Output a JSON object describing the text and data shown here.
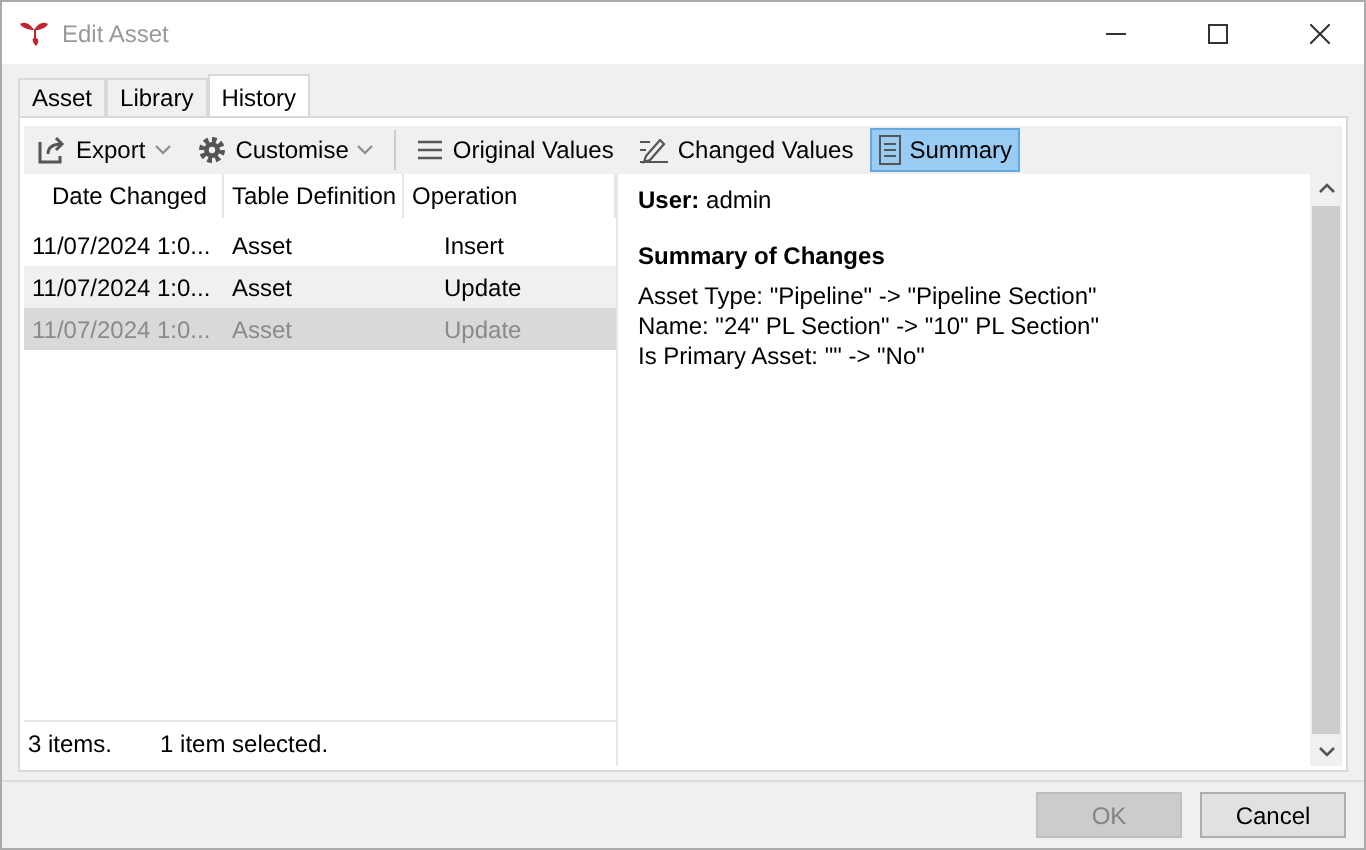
{
  "window": {
    "title": "Edit Asset"
  },
  "tabs": [
    {
      "label": "Asset",
      "selected": false
    },
    {
      "label": "Library",
      "selected": false
    },
    {
      "label": "History",
      "selected": true
    }
  ],
  "toolbar": [
    {
      "kind": "dropdown",
      "label": "Export",
      "selected": false
    },
    {
      "kind": "dropdown",
      "label": "Customise",
      "selected": false
    },
    {
      "kind": "separator"
    },
    {
      "kind": "toggle",
      "label": "Original Values",
      "selected": false
    },
    {
      "kind": "toggle",
      "label": "Changed Values",
      "selected": false
    },
    {
      "kind": "toggle",
      "label": "Summary",
      "selected": true
    }
  ],
  "table": {
    "columns": [
      "Date Changed",
      "Table Definition",
      "Operation"
    ],
    "rows": [
      {
        "cells": [
          "11/07/2024 1:0...",
          "Asset",
          "Insert"
        ],
        "selected": false,
        "hovered": false
      },
      {
        "cells": [
          "11/07/2024 1:0...",
          "Asset",
          "Update"
        ],
        "selected": false,
        "hovered": true
      },
      {
        "cells": [
          "11/07/2024 1:0...",
          "Asset",
          "Update"
        ],
        "selected": true,
        "hovered": false
      }
    ]
  },
  "status_bar": {
    "count": "3 items.",
    "selection": "1 item selected."
  },
  "summary": {
    "user_label": "User:",
    "user": "admin",
    "heading": "Summary of Changes",
    "lines": [
      "Asset Type: \"Pipeline\" -> \"Pipeline Section\"",
      "Name: \"24\" PL Section\" -> \"10\" PL Section\"",
      "Is Primary Asset: \"\" -> \"No\""
    ]
  },
  "buttons": [
    {
      "label": "OK",
      "disabled": true
    },
    {
      "label": "Cancel",
      "disabled": false
    }
  ]
}
